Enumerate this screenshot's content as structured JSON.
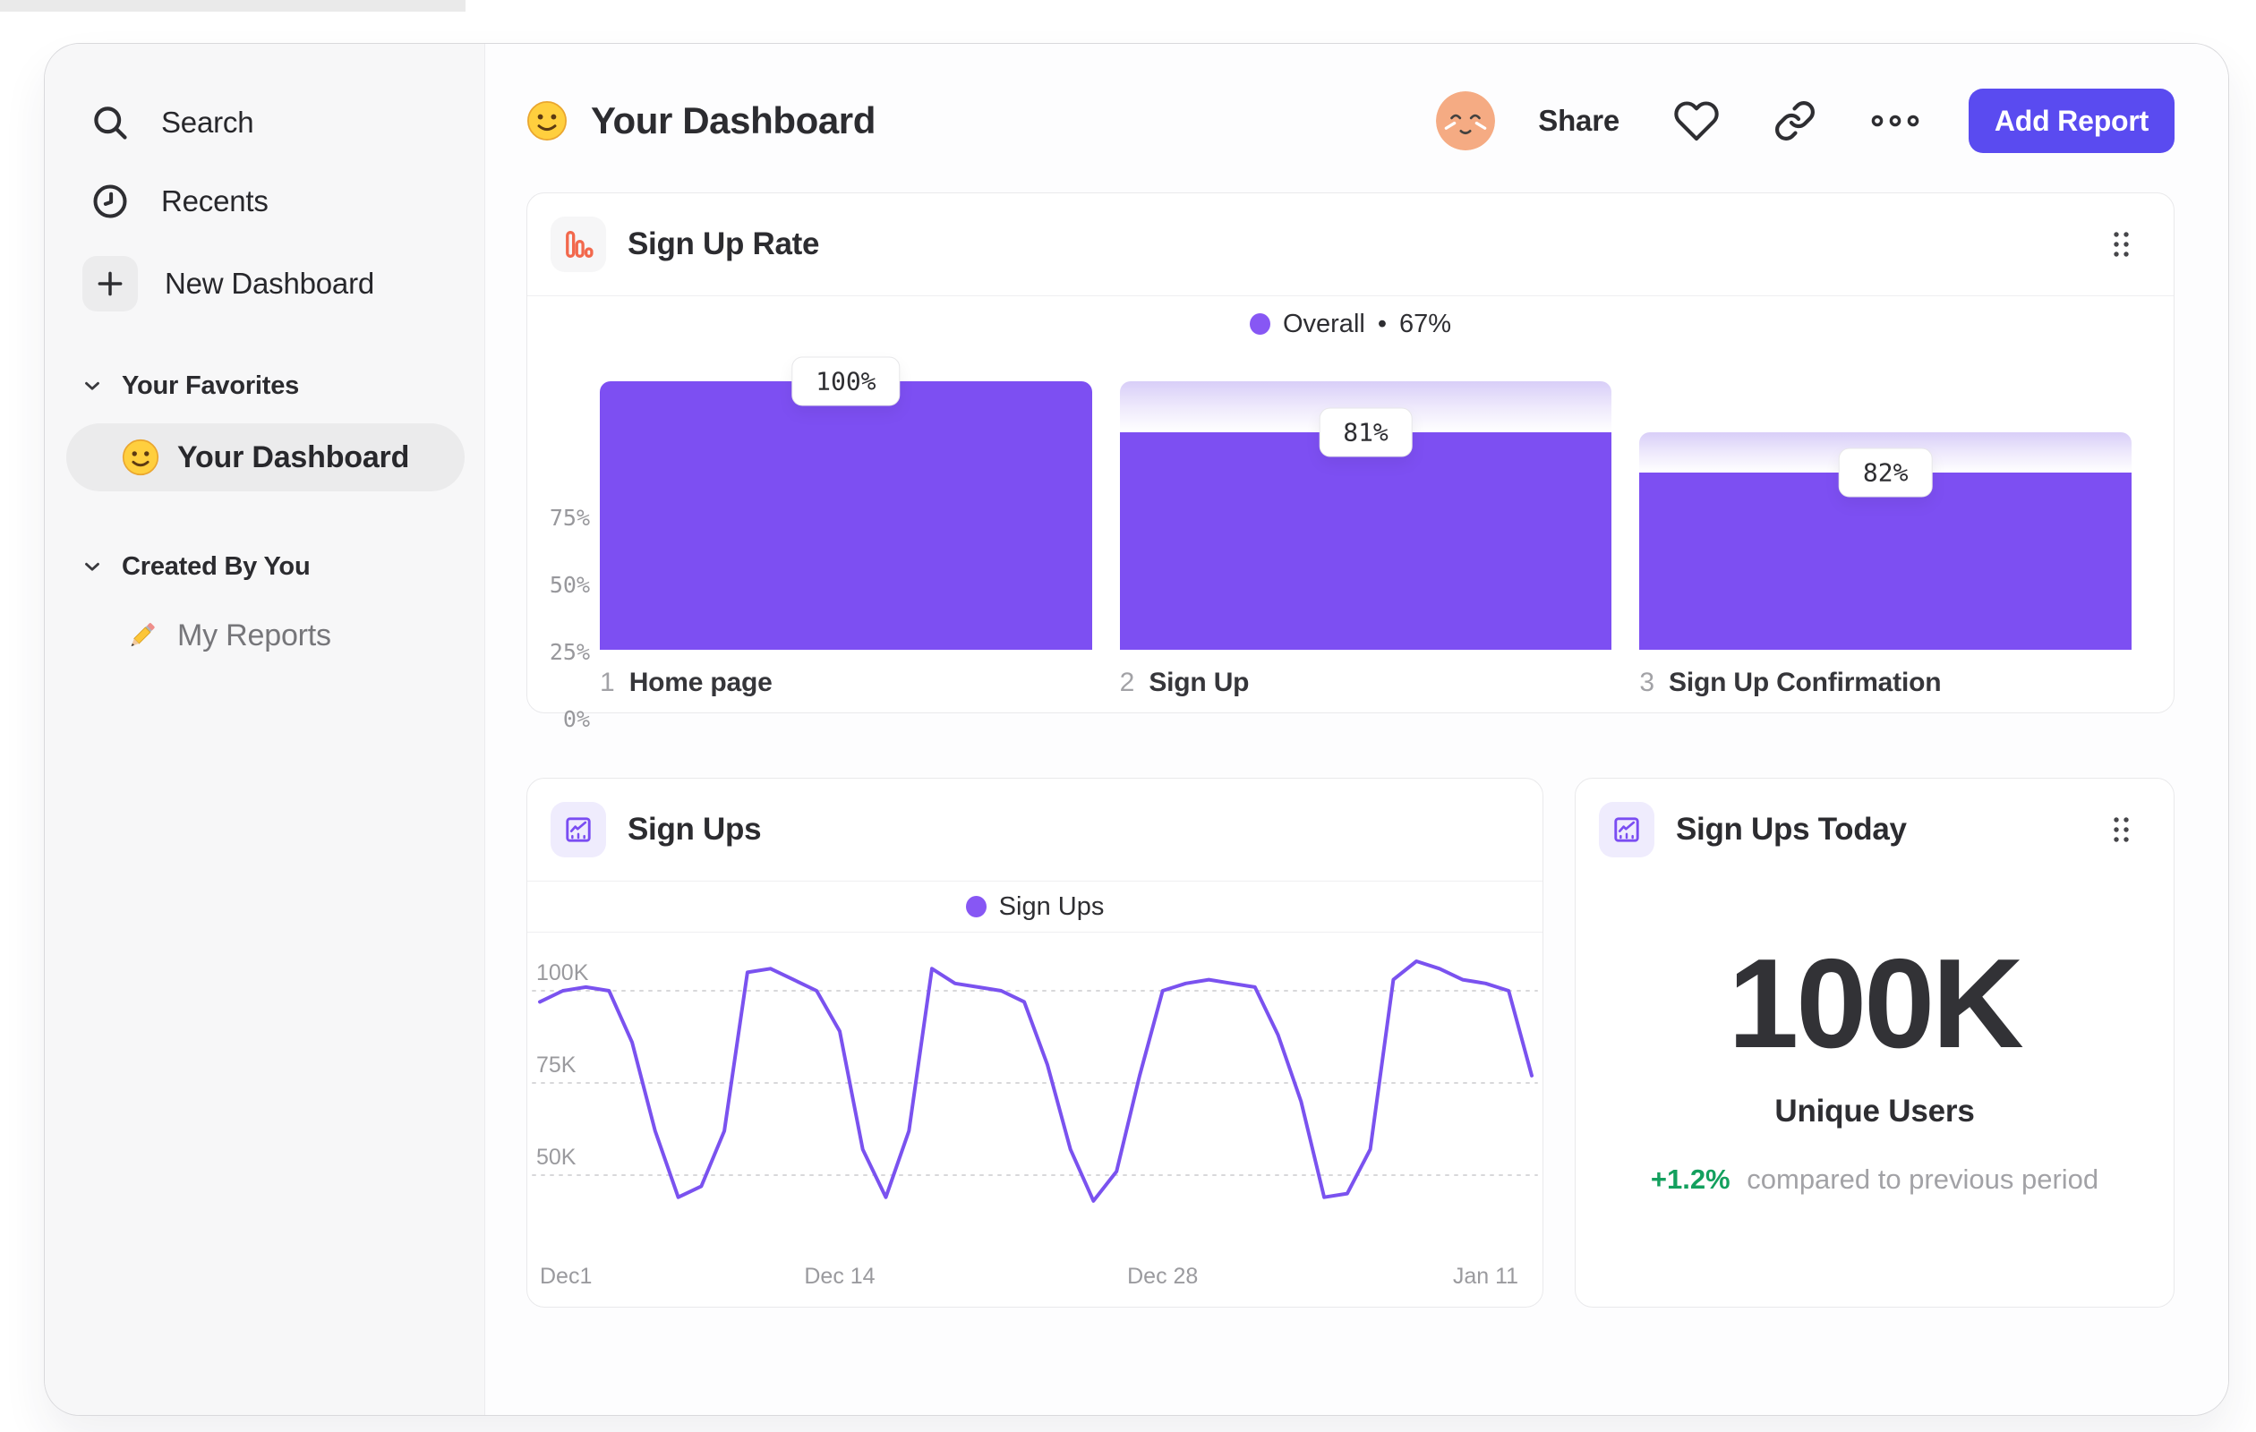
{
  "sidebar": {
    "items": [
      {
        "label": "Search",
        "icon": "search-icon"
      },
      {
        "label": "Recents",
        "icon": "clock-icon"
      },
      {
        "label": "New Dashboard",
        "icon": "plus-icon"
      }
    ],
    "sections": [
      {
        "title": "Your Favorites",
        "items": [
          {
            "label": "Your Dashboard",
            "icon": "smiley-emoji",
            "active": true
          }
        ]
      },
      {
        "title": "Created By You",
        "items": [
          {
            "label": "My Reports",
            "icon": "pencil-emoji",
            "active": false
          }
        ]
      }
    ]
  },
  "header": {
    "title": "Your Dashboard",
    "share_label": "Share",
    "add_report_label": "Add Report"
  },
  "colors": {
    "accent_purple": "#7d4ff2",
    "line_purple": "#7a52ef",
    "legend_dot_purple": "#8757f4",
    "button_indigo": "#5a4bf0",
    "icon_orange": "#f2684c",
    "positive_green": "#13a05e"
  },
  "cards": {
    "signups_today": {
      "title": "Sign Ups Today",
      "value": "100K",
      "subtitle": "Unique Users",
      "delta": "+1.2%",
      "delta_note": "compared to previous period"
    }
  },
  "chart_data": [
    {
      "type": "bar",
      "variant": "funnel",
      "title": "Sign Up Rate",
      "legend": {
        "label": "Overall",
        "separator": "•",
        "value": "67%"
      },
      "legend_position": "top-center",
      "categories": [
        "Home page",
        "Sign Up",
        "Sign Up Confirmation"
      ],
      "category_numbers": [
        "1",
        "2",
        "3"
      ],
      "step_conversion_labels": [
        "100%",
        "81%",
        "82%"
      ],
      "overall_heights_pct": [
        100,
        81,
        66
      ],
      "y_ticks": [
        {
          "label": "75%",
          "value": 75
        },
        {
          "label": "50%",
          "value": 50
        },
        {
          "label": "25%",
          "value": 25
        },
        {
          "label": "0%",
          "value": 0
        }
      ],
      "ylim": [
        0,
        100
      ],
      "grid": false
    },
    {
      "type": "line",
      "title": "Sign Ups",
      "legend": {
        "label": "Sign Ups"
      },
      "legend_position": "top-center",
      "unit": "K",
      "x_ticks": [
        {
          "label": "Dec1",
          "index": 0
        },
        {
          "label": "Dec 14",
          "index": 13
        },
        {
          "label": "Dec 28",
          "index": 27
        },
        {
          "label": "Jan 11",
          "index": 41
        }
      ],
      "y_ticks": [
        {
          "label": "100K",
          "value": 100
        },
        {
          "label": "75K",
          "value": 75
        },
        {
          "label": "50K",
          "value": 50
        }
      ],
      "values": [
        97,
        100,
        101,
        100,
        86,
        62,
        44,
        47,
        62,
        105,
        106,
        103,
        100,
        89,
        57,
        44,
        62,
        106,
        102,
        101,
        100,
        97,
        80,
        57,
        43,
        51,
        77,
        100,
        102,
        103,
        102,
        101,
        88,
        70,
        44,
        45,
        57,
        103,
        108,
        106,
        103,
        102,
        100,
        77
      ],
      "ylim": [
        40,
        112
      ],
      "grid": "dotted-horizontal"
    }
  ]
}
